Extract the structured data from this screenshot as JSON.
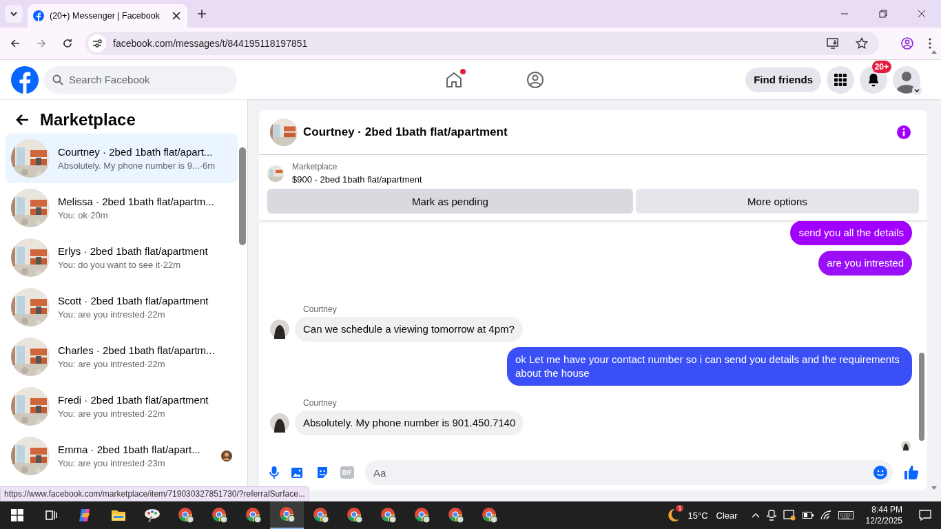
{
  "browser": {
    "tab_title": "(20+) Messenger | Facebook",
    "url": "facebook.com/messages/t/844195118197851",
    "status_url": "https://www.facebook.com/marketplace/item/719030327851730/?referralSurface..."
  },
  "header": {
    "search_placeholder": "Search Facebook",
    "home_unread": true,
    "find_friends": "Find friends",
    "notification_badge": "20+"
  },
  "sidebar": {
    "title": "Marketplace",
    "conversations": [
      {
        "name": "Courtney · 2bed 1bath flat/apart...",
        "preview": "Absolutely. My phone number is 9...",
        "time": "·6m",
        "selected": true,
        "seen": false
      },
      {
        "name": "Melissa · 2bed 1bath flat/apartm...",
        "preview": "You: ok",
        "time": "·20m",
        "selected": false,
        "seen": false
      },
      {
        "name": "Erlys · 2bed 1bath flat/apartment",
        "preview": "You: do you want to see it",
        "time": "·22m",
        "selected": false,
        "seen": false
      },
      {
        "name": "Scott · 2bed 1bath flat/apartment",
        "preview": "You: are you intrested",
        "time": "·22m",
        "selected": false,
        "seen": false
      },
      {
        "name": "Charles · 2bed 1bath flat/apartm...",
        "preview": "You: are you intrested",
        "time": "·22m",
        "selected": false,
        "seen": false
      },
      {
        "name": "Fredi · 2bed 1bath flat/apartment",
        "preview": "You: are you intrested",
        "time": "·22m",
        "selected": false,
        "seen": false
      },
      {
        "name": "Emma · 2bed 1bath flat/apart...",
        "preview": "You: are you intrested",
        "time": "·23m",
        "selected": false,
        "seen": true
      }
    ]
  },
  "chat": {
    "title": "Courtney · 2bed 1bath flat/apartment",
    "listing_label": "Marketplace",
    "listing_title": "$900 - 2bed 1bath flat/apartment",
    "buttons": [
      {
        "label": "Mark as pending",
        "selected": true
      },
      {
        "label": "More options",
        "selected": false
      }
    ],
    "messages": [
      {
        "kind": "sent",
        "text": "send you all the details",
        "color": "#a100ff"
      },
      {
        "kind": "sent",
        "text": "are you intrested",
        "color": "#9a0ff7"
      },
      {
        "kind": "received",
        "sender": "Courtney",
        "text": "Can we schedule a viewing tomorrow at 4pm?"
      },
      {
        "kind": "sent",
        "text": "ok Let me have your contact number so i can send you details and the requirements about the house",
        "color": "#3a4ff6"
      },
      {
        "kind": "received",
        "sender": "Courtney",
        "text": "Absolutely. My phone number is 901.450.7140"
      }
    ],
    "composer_placeholder": "Aa"
  },
  "taskbar": {
    "apps": [
      {
        "kind": "start",
        "selected": false
      },
      {
        "kind": "taskview",
        "selected": false
      },
      {
        "kind": "copilot",
        "selected": false
      },
      {
        "kind": "folder",
        "selected": false
      },
      {
        "kind": "paint",
        "selected": false
      },
      {
        "kind": "chrome",
        "selected": false
      },
      {
        "kind": "chrome",
        "selected": false
      },
      {
        "kind": "chrome",
        "selected": false
      },
      {
        "kind": "chrome",
        "selected": true
      },
      {
        "kind": "chrome",
        "selected": false
      },
      {
        "kind": "chrome",
        "selected": false
      },
      {
        "kind": "chrome",
        "selected": false
      },
      {
        "kind": "chrome",
        "selected": false
      },
      {
        "kind": "chrome",
        "selected": false
      },
      {
        "kind": "chrome",
        "selected": false
      }
    ],
    "weather_badge": "1",
    "temperature": "15°C",
    "weather": "Clear",
    "time": "8:44 PM",
    "date": "12/2/2025"
  }
}
